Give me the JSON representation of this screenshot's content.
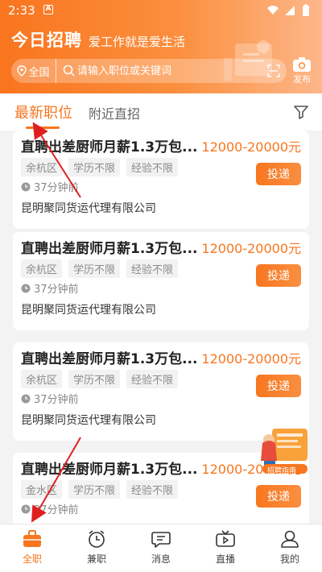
{
  "status_bar": {
    "time": "2:33",
    "notification_badge": "A"
  },
  "header": {
    "app_name": "今日招聘",
    "slogan": "爱工作就是爱生活",
    "city": "全国",
    "search_placeholder": "请输入职位或关键词",
    "publish_label": "发布"
  },
  "tabs": {
    "latest": "最新职位",
    "nearby": "附近直招"
  },
  "jobs": [
    {
      "title": "直聘出差厨师月薪1.3万包...",
      "salary": "12000-20000元",
      "tags": [
        "余杭区",
        "学历不限",
        "经验不限"
      ],
      "posted": "37分钟前",
      "company": "昆明聚同货运代理有限公司",
      "apply": "投递"
    },
    {
      "title": "直聘出差厨师月薪1.3万包...",
      "salary": "12000-20000元",
      "tags": [
        "余杭区",
        "学历不限",
        "经验不限"
      ],
      "posted": "37分钟前",
      "company": "昆明聚同货运代理有限公司",
      "apply": "投递"
    },
    {
      "title": "直聘出差厨师月薪1.3万包...",
      "salary": "12000-20000元",
      "tags": [
        "余杭区",
        "学历不限",
        "经验不限"
      ],
      "posted": "37分钟前",
      "company": "昆明聚同货运代理有限公司",
      "apply": "投递"
    },
    {
      "title": "直聘出差厨师月薪1.3万包...",
      "salary": "12000-20000元",
      "tags": [
        "金水区",
        "学历不限",
        "经验不限"
      ],
      "posted": "37分钟前",
      "company": "",
      "apply": "投递"
    }
  ],
  "float_ad": {
    "label": "招聘指南"
  },
  "bottom_nav": [
    {
      "label": "全职",
      "icon": "briefcase-icon",
      "active": true
    },
    {
      "label": "兼职",
      "icon": "clock-icon",
      "active": false
    },
    {
      "label": "消息",
      "icon": "message-icon",
      "active": false
    },
    {
      "label": "直播",
      "icon": "tv-icon",
      "active": false
    },
    {
      "label": "我的",
      "icon": "user-icon",
      "active": false
    }
  ],
  "colors": {
    "accent": "#f7761f",
    "arrow": "#e02020"
  }
}
